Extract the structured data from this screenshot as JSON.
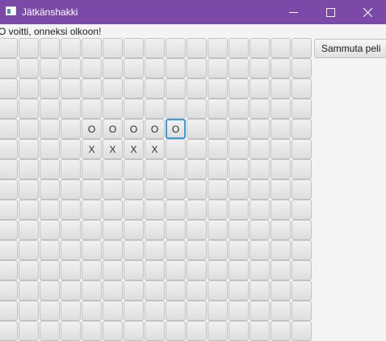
{
  "window": {
    "title": "Jätkänshakki",
    "title_bar_color": "#7b4aa8",
    "icon": "app-window-icon",
    "controls": [
      "minimize-icon",
      "maximize-icon",
      "close-icon"
    ]
  },
  "status": {
    "message": "O voitti, onneksi olkoon!"
  },
  "end_game_button": {
    "label": "Sammuta peli"
  },
  "board": {
    "columns": 15,
    "rows": 15,
    "cells": [
      [
        "",
        "",
        "",
        "",
        "",
        "",
        "",
        "",
        "",
        "",
        "",
        "",
        "",
        "",
        ""
      ],
      [
        "",
        "",
        "",
        "",
        "",
        "",
        "",
        "",
        "",
        "",
        "",
        "",
        "",
        "",
        ""
      ],
      [
        "",
        "",
        "",
        "",
        "",
        "",
        "",
        "",
        "",
        "",
        "",
        "",
        "",
        "",
        ""
      ],
      [
        "",
        "",
        "",
        "",
        "",
        "",
        "",
        "",
        "",
        "",
        "",
        "",
        "",
        "",
        ""
      ],
      [
        "",
        "",
        "",
        "",
        "O",
        "O",
        "O",
        "O",
        "O",
        "",
        "",
        "",
        "",
        "",
        ""
      ],
      [
        "",
        "",
        "",
        "",
        "X",
        "X",
        "X",
        "X",
        "",
        "",
        "",
        "",
        "",
        "",
        ""
      ],
      [
        "",
        "",
        "",
        "",
        "",
        "",
        "",
        "",
        "",
        "",
        "",
        "",
        "",
        "",
        ""
      ],
      [
        "",
        "",
        "",
        "",
        "",
        "",
        "",
        "",
        "",
        "",
        "",
        "",
        "",
        "",
        ""
      ],
      [
        "",
        "",
        "",
        "",
        "",
        "",
        "",
        "",
        "",
        "",
        "",
        "",
        "",
        "",
        ""
      ],
      [
        "",
        "",
        "",
        "",
        "",
        "",
        "",
        "",
        "",
        "",
        "",
        "",
        "",
        "",
        ""
      ],
      [
        "",
        "",
        "",
        "",
        "",
        "",
        "",
        "",
        "",
        "",
        "",
        "",
        "",
        "",
        ""
      ],
      [
        "",
        "",
        "",
        "",
        "",
        "",
        "",
        "",
        "",
        "",
        "",
        "",
        "",
        "",
        ""
      ],
      [
        "",
        "",
        "",
        "",
        "",
        "",
        "",
        "",
        "",
        "",
        "",
        "",
        "",
        "",
        ""
      ],
      [
        "",
        "",
        "",
        "",
        "",
        "",
        "",
        "",
        "",
        "",
        "",
        "",
        "",
        "",
        ""
      ],
      [
        "",
        "",
        "",
        "",
        "",
        "",
        "",
        "",
        "",
        "",
        "",
        "",
        "",
        "",
        ""
      ]
    ],
    "focused_cell": {
      "row": 4,
      "col": 8
    }
  }
}
